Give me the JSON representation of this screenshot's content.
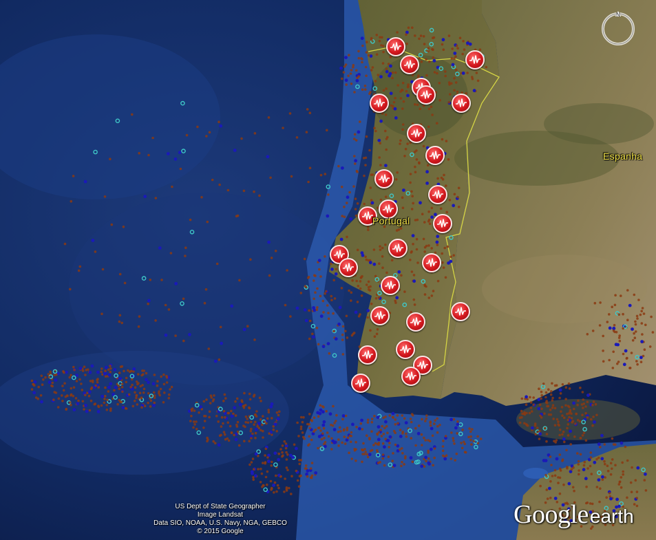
{
  "app": {
    "name": "Google Earth"
  },
  "map": {
    "labels": {
      "portugal": "Portugal",
      "espanha": "Espanha"
    },
    "layers": {
      "stations": {
        "icon": "seismograph-icon",
        "count": 29
      },
      "earthquakes_small": {
        "color": "#8b3a12"
      },
      "earthquakes_medium": {
        "color": "#1a1ab8"
      },
      "earthquakes_large": {
        "color": "#3fc8c8"
      }
    },
    "colors": {
      "ocean_deep": "#0d2150",
      "ocean_shelf": "#2a5cb0",
      "land": "#6d6a3a",
      "border": "#d6d645",
      "station": "#d4181e"
    }
  },
  "compass": {
    "north_label": "N"
  },
  "attribution": {
    "line1": "US Dept of State Geographer",
    "line2": "Image Landsat",
    "line3": "Data SIO, NOAA, U.S. Navy, NGA, GEBCO",
    "line4": "© 2015 Google"
  },
  "logo": {
    "part1": "Google",
    "part2": "earth"
  }
}
